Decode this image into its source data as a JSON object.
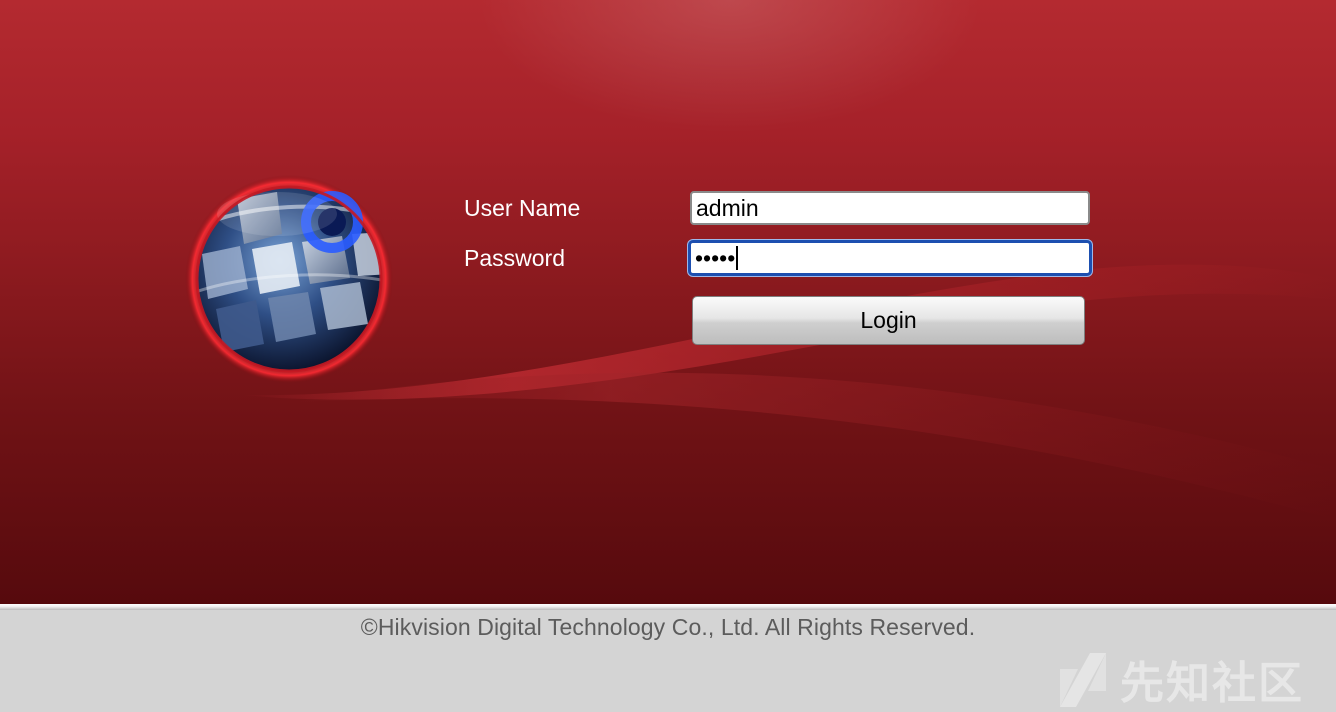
{
  "login_form": {
    "username_label": "User Name",
    "username_value": "admin",
    "password_label": "Password",
    "password_masked": "•••••",
    "login_button_label": "Login"
  },
  "footer": {
    "copyright": "©Hikvision Digital Technology Co., Ltd. All Rights Reserved.",
    "watermark_text": "先知社区"
  },
  "colors": {
    "banner_red": "#a52129",
    "banner_dark": "#560a0d",
    "footer_gray": "#d4d4d4",
    "focus_blue": "#1d4fb0"
  },
  "icons": {
    "logo": "hikvision-sphere-logo",
    "watermark_logo": "xianzhi-logo-icon"
  }
}
